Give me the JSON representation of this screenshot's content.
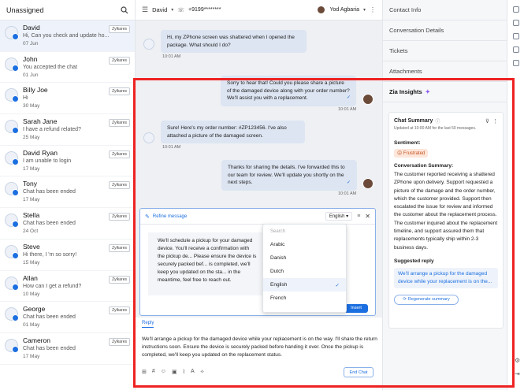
{
  "left": {
    "title": "Unassigned",
    "items": [
      {
        "name": "David",
        "preview": "Hi, Can you check and update ho...",
        "date": "07 Jun",
        "tag": "Zylkares"
      },
      {
        "name": "John",
        "preview": "You accepted the chat",
        "date": "01 Jun",
        "tag": "Zylkares"
      },
      {
        "name": "Billy Joe",
        "preview": "Hi",
        "date": "30 May",
        "tag": "Zylkares"
      },
      {
        "name": "Sarah Jane",
        "preview": "I have a refund related?",
        "date": "25 May",
        "tag": "Zylkares"
      },
      {
        "name": "David Ryan",
        "preview": "I am unable to login",
        "date": "17 May",
        "tag": "Zylkares"
      },
      {
        "name": "Tony",
        "preview": "Chat has been ended",
        "date": "17 May",
        "tag": "Zylkares"
      },
      {
        "name": "Stella",
        "preview": "Chat has been ended",
        "date": "24 Oct",
        "tag": "Zylkares"
      },
      {
        "name": "Steve",
        "preview": "Hi there, I 'm so sorry!",
        "date": "15 May",
        "tag": "Zylkares"
      },
      {
        "name": "Allan",
        "preview": "How can I get a refund?",
        "date": "10 May",
        "tag": "Zylkares"
      },
      {
        "name": "George",
        "preview": "Chat has been ended",
        "date": "01 May",
        "tag": "Zylkares"
      },
      {
        "name": "Cameron",
        "preview": "Chat has been ended",
        "date": "17 May",
        "tag": "Zylkares"
      }
    ]
  },
  "header": {
    "contact": "David",
    "phone": "+9199********",
    "agent": "Yod Agbaria"
  },
  "messages": [
    {
      "text": "Hi, my ZPhone screen was shattered when I opened the package. What should I do?",
      "time": "10:01 AM"
    },
    {
      "text": "Sorry to hear that! Could you please share a picture of the damaged device along with your order number? We'll assist you with a replacement.",
      "time": "10:01 AM"
    },
    {
      "text": "Sure! Here's my order number: #ZP123456. I've also attached a picture of the damaged screen.",
      "time": "10:01 AM"
    },
    {
      "text": "Thanks for sharing the details. I've forwarded this to our team for review. We'll update you shortly on the next steps.",
      "time": "10:01 AM"
    }
  ],
  "refine": {
    "title": "Refine message",
    "language": "English",
    "search_placeholder": "Search",
    "body": "We'll schedule a pickup for your damaged device. You'll receive a confirmation with the pickup de... Please ensure the device is securely packed bef... is completed, we'll keep you updated on the sta... in the meantime, feel free to reach out.",
    "insert": "Insert",
    "options": [
      "Arabic",
      "Danish",
      "Dutch",
      "English",
      "French"
    ],
    "selected": "English"
  },
  "reply": {
    "tab": "Reply",
    "text": "We'll arrange a pickup for the damaged device while your replacement is on the way. I'll share the return instructions soon. Ensure the device is securely packed before handing it over. Once the pickup is completed, we'll keep you updated on the replacement status.",
    "end_chat": "End Chat"
  },
  "right": {
    "sections": [
      "Contact Info",
      "Conversation Details",
      "Tickets",
      "Attachments"
    ],
    "zia_title": "Zia Insights",
    "summary_title": "Chat Summary",
    "updated": "Updated at 10:00 AM for the last 50 messages.",
    "sentiment_label": "Sentiment:",
    "sentiment": "Frustrated",
    "conv_label": "Conversation Summary:",
    "conv_text": "The customer reported receiving a shattered ZPhone upon delivery. Support requested a picture of the damage and the order number, which the customer provided. Support then escalated the issue for review and informed the customer about the replacement process. The customer inquired about the replacement timeline, and support assured them that replacements typically ship within 2-3 business days.",
    "suggested_label": "Suggested reply",
    "suggested_text": "We'll arrange a pickup for the damaged device while your replacement is on the...",
    "regen": "Regenerate summary"
  },
  "colors": {
    "accent": "#1c6fe0",
    "highlight": "#e22"
  }
}
